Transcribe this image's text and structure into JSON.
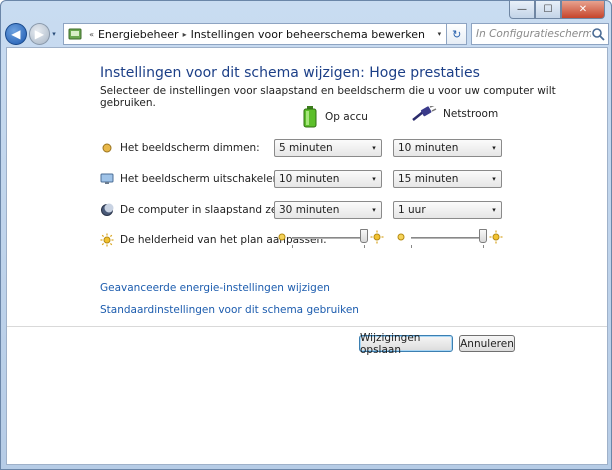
{
  "window": {
    "caption_buttons": {
      "minimize": "—",
      "maximize": "☐",
      "close": "✕"
    }
  },
  "nav": {
    "back_symbol": "◀",
    "forward_symbol": "▶",
    "history_arrow": "▾",
    "breadcrumb_lead": "«",
    "breadcrumb": [
      "Energiebeheer",
      "Instellingen voor beheerschema bewerken"
    ],
    "breadcrumb_sep": "▸",
    "address_dropdown": "▾",
    "refresh_symbol": "↻",
    "search_placeholder": "In Configuratiescherm zoeken",
    "icons": {
      "address": "control-panel-icon",
      "search": "search-icon"
    }
  },
  "page": {
    "title": "Instellingen voor dit schema wijzigen: Hoge prestaties",
    "subtitle": "Selecteer de instellingen voor slaapstand en beeldscherm die u voor uw computer wilt gebruiken.",
    "columns": {
      "battery": "Op accu",
      "plugged": "Netstroom"
    },
    "rows": [
      {
        "label": "Het beeldscherm dimmen:",
        "battery": "5 minuten",
        "plugged": "10 minuten",
        "icon": "dim-display-icon"
      },
      {
        "label": "Het beeldscherm uitschakelen na:",
        "battery": "10 minuten",
        "plugged": "15 minuten",
        "icon": "monitor-icon"
      },
      {
        "label": "De computer in slaapstand zetten na:",
        "battery": "30 minuten",
        "plugged": "1 uur",
        "icon": "sleep-moon-icon"
      }
    ],
    "brightness": {
      "label": "De helderheid van het plan aanpassen:",
      "battery_level": 1.0,
      "plugged_level": 1.0,
      "icon": "brightness-sun-icon"
    },
    "links": {
      "advanced": "Geavanceerde energie-instellingen wijzigen",
      "restore": "Standaardinstellingen voor dit schema gebruiken"
    },
    "buttons": {
      "save": "Wijzigingen opslaan",
      "cancel": "Annuleren"
    },
    "dropdown_arrow": "▾"
  },
  "colors": {
    "title": "#1c3f87",
    "link": "#1c5cae",
    "battery": "#4caf24",
    "plug": "#2b2b6b"
  }
}
